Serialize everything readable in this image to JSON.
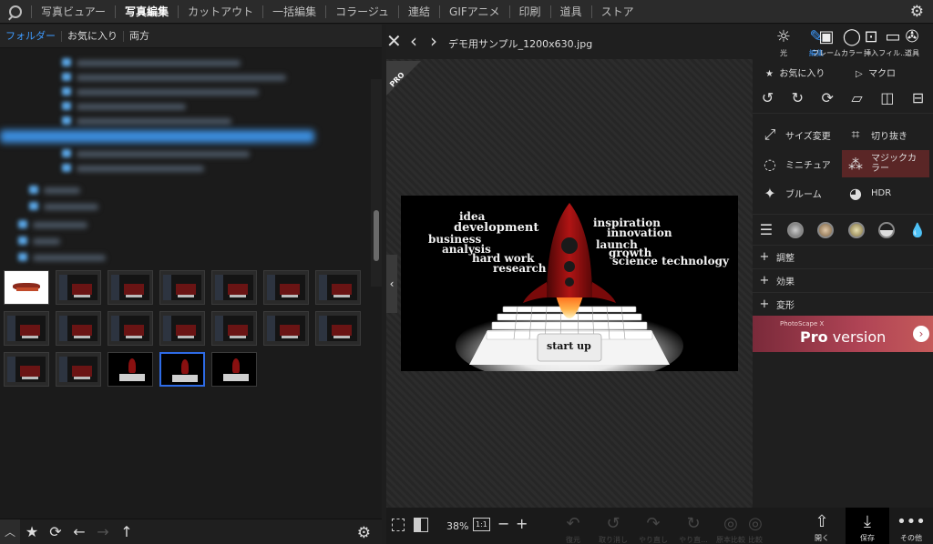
{
  "menu": {
    "items": [
      "写真ビュアー",
      "写真編集",
      "カットアウト",
      "一括編集",
      "コラージュ",
      "連結",
      "GIFアニメ",
      "印刷",
      "道具",
      "ストア"
    ],
    "active_index": 1
  },
  "left_tabs": [
    "フォルダー",
    "お気に入り",
    "両方"
  ],
  "editor": {
    "filename": "デモ用サンプル_1200x630.jpg",
    "pro_badge": "PRO"
  },
  "photo_words": {
    "idea": "idea",
    "development": "development",
    "business": "business",
    "analysis": "analysis",
    "hard_work": "hard work",
    "research": "research",
    "inspiration": "inspiration",
    "innovation": "innovation",
    "launch": "launch",
    "growth": "growth",
    "science_technology": "science technology",
    "start_up": "start up"
  },
  "right_tabs": [
    {
      "label": "編集",
      "icon": "edit-icon"
    },
    {
      "label": "カラー",
      "icon": "color-icon"
    },
    {
      "label": "フィル...",
      "icon": "filter-icon"
    },
    {
      "label": "光",
      "icon": "light-icon"
    },
    {
      "label": "フレーム",
      "icon": "frame-icon"
    },
    {
      "label": "挿入",
      "icon": "insert-icon"
    },
    {
      "label": "道具",
      "icon": "tools-icon"
    }
  ],
  "right_panel": {
    "favorites": "お気に入り",
    "macro": "マクロ",
    "resize": "サイズ変更",
    "crop": "切り抜き",
    "miniature": "ミニチュア",
    "magic_color": "マジックカラー",
    "bloom": "ブルーム",
    "hdr": "HDR",
    "sections": [
      "調整",
      "効果",
      "変形"
    ],
    "promo_small": "PhotoScape X",
    "promo_pro": "Pro",
    "promo_version": " version"
  },
  "footer": {
    "zoom": "38%",
    "one_to_one": "1:1",
    "disabled_buttons": [
      "復元",
      "取り消し",
      "やり直し",
      "やり直...",
      "原本比較",
      "比較"
    ],
    "open": "開く",
    "save": "保存",
    "more": "その他"
  }
}
